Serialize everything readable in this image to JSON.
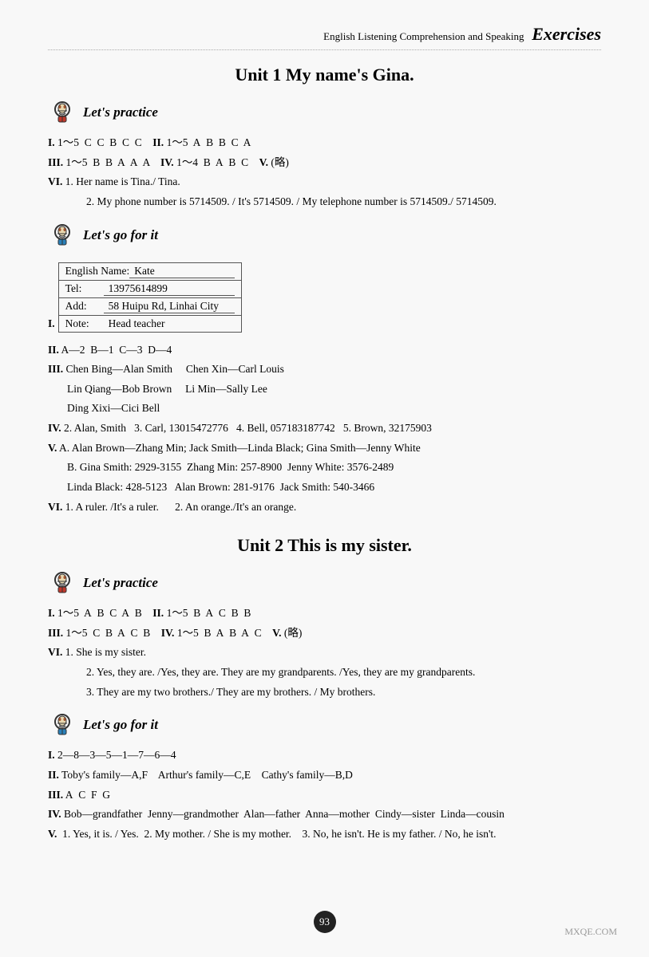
{
  "header": {
    "subtitle": "English Listening Comprehension and Speaking",
    "title": "Exercises"
  },
  "unit1": {
    "title": "Unit 1  My name's Gina.",
    "lets_practice": {
      "heading": "Let's practice",
      "lines": [
        {
          "id": "I",
          "text": "I. 1～5  C  C  B  C  C    II. 1～5  A  B  B  C  A"
        },
        {
          "id": "III",
          "text": "III. 1～5  B  B  A  A  A    IV. 1～4  B  A  B  C    V. (略)"
        },
        {
          "id": "VI_label",
          "text": "VI. 1. Her name is Tina./ Tina."
        },
        {
          "id": "VI_2",
          "text": "2. My phone number is 5714509. / It's 5714509. / My telephone number is 5714509./ 5714509."
        }
      ]
    },
    "lets_go_for_it": {
      "heading": "Let's go for it",
      "table": {
        "rows": [
          {
            "label": "English Name:",
            "value": "Kate"
          },
          {
            "label": "Tel:",
            "value": "13975614899"
          },
          {
            "label": "Add:",
            "value": "58 Huipu Rd, Linhai City"
          },
          {
            "label": "Note:",
            "value": "Head teacher"
          }
        ]
      },
      "lines": [
        {
          "text": "II. A—2  B—1  C—3  D—4"
        },
        {
          "text": "III. Chen Bing—Alan Smith    Chen Xin—Carl Louis"
        },
        {
          "text": "Lin Qiang—Bob Brown    Li Min—Sally Lee"
        },
        {
          "text": "Ding Xixi—Cici Bell"
        },
        {
          "text": "IV. 2. Alan, Smith   3. Carl, 13015472776   4. Bell, 057183187742   5. Brown, 32175903"
        },
        {
          "text": "V. A. Alan Brown—Zhang Min; Jack Smith—Linda Black; Gina Smith—Jenny White"
        },
        {
          "text": "B. Gina Smith: 2929-3155  Zhang Min: 257-8900  Jenny White: 3576-2489"
        },
        {
          "text": "Linda Black: 428-5123   Alan Brown: 281-9176  Jack Smith: 540-3466"
        },
        {
          "text": "VI. 1. A ruler. /It's a ruler.      2. An orange./It's an orange."
        }
      ]
    }
  },
  "unit2": {
    "title": "Unit 2  This is my sister.",
    "lets_practice": {
      "heading": "Let's practice",
      "lines": [
        {
          "text": "I. 1～5  A  B  C  A  B    II. 1～5  B  A  C  B  B"
        },
        {
          "text": "III. 1～5  C  B  A  C  B    IV. 1～5  B  A  B  A  C    V. (略)"
        },
        {
          "text": "VI. 1. She is my sister."
        },
        {
          "text": "2. Yes, they are. /Yes, they are. They are my grandparents. /Yes, they are my grandparents."
        },
        {
          "text": "3. They are my two brothers./ They are my brothers. / My brothers."
        }
      ]
    },
    "lets_go_for_it": {
      "heading": "Let's go for it",
      "lines": [
        {
          "text": "I. 2—8—3—5—1—7—6—4"
        },
        {
          "text": "II. Toby's family—A,F    Arthur's family—C,E    Cathy's family—B,D"
        },
        {
          "text": "III. A  C  F  G"
        },
        {
          "text": "IV. Bob—grandfather  Jenny—grandmother  Alan—father  Anna—mother  Cindy—sister  Linda—cousin"
        },
        {
          "text": "V.  1. Yes, it is. / Yes.  2. My mother. / She is my mother.   3. No, he isn't. He is my father. / No, he isn't."
        }
      ]
    }
  },
  "page_number": "93"
}
